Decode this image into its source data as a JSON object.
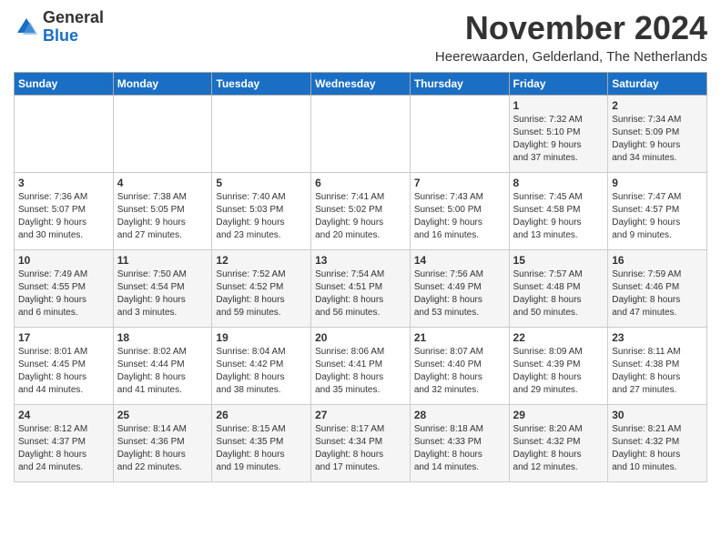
{
  "header": {
    "title": "November 2024",
    "location": "Heerewaarden, Gelderland, The Netherlands",
    "logo_general": "General",
    "logo_blue": "Blue"
  },
  "days_of_week": [
    "Sunday",
    "Monday",
    "Tuesday",
    "Wednesday",
    "Thursday",
    "Friday",
    "Saturday"
  ],
  "weeks": [
    [
      {
        "day": "",
        "info": ""
      },
      {
        "day": "",
        "info": ""
      },
      {
        "day": "",
        "info": ""
      },
      {
        "day": "",
        "info": ""
      },
      {
        "day": "",
        "info": ""
      },
      {
        "day": "1",
        "info": "Sunrise: 7:32 AM\nSunset: 5:10 PM\nDaylight: 9 hours\nand 37 minutes."
      },
      {
        "day": "2",
        "info": "Sunrise: 7:34 AM\nSunset: 5:09 PM\nDaylight: 9 hours\nand 34 minutes."
      }
    ],
    [
      {
        "day": "3",
        "info": "Sunrise: 7:36 AM\nSunset: 5:07 PM\nDaylight: 9 hours\nand 30 minutes."
      },
      {
        "day": "4",
        "info": "Sunrise: 7:38 AM\nSunset: 5:05 PM\nDaylight: 9 hours\nand 27 minutes."
      },
      {
        "day": "5",
        "info": "Sunrise: 7:40 AM\nSunset: 5:03 PM\nDaylight: 9 hours\nand 23 minutes."
      },
      {
        "day": "6",
        "info": "Sunrise: 7:41 AM\nSunset: 5:02 PM\nDaylight: 9 hours\nand 20 minutes."
      },
      {
        "day": "7",
        "info": "Sunrise: 7:43 AM\nSunset: 5:00 PM\nDaylight: 9 hours\nand 16 minutes."
      },
      {
        "day": "8",
        "info": "Sunrise: 7:45 AM\nSunset: 4:58 PM\nDaylight: 9 hours\nand 13 minutes."
      },
      {
        "day": "9",
        "info": "Sunrise: 7:47 AM\nSunset: 4:57 PM\nDaylight: 9 hours\nand 9 minutes."
      }
    ],
    [
      {
        "day": "10",
        "info": "Sunrise: 7:49 AM\nSunset: 4:55 PM\nDaylight: 9 hours\nand 6 minutes."
      },
      {
        "day": "11",
        "info": "Sunrise: 7:50 AM\nSunset: 4:54 PM\nDaylight: 9 hours\nand 3 minutes."
      },
      {
        "day": "12",
        "info": "Sunrise: 7:52 AM\nSunset: 4:52 PM\nDaylight: 8 hours\nand 59 minutes."
      },
      {
        "day": "13",
        "info": "Sunrise: 7:54 AM\nSunset: 4:51 PM\nDaylight: 8 hours\nand 56 minutes."
      },
      {
        "day": "14",
        "info": "Sunrise: 7:56 AM\nSunset: 4:49 PM\nDaylight: 8 hours\nand 53 minutes."
      },
      {
        "day": "15",
        "info": "Sunrise: 7:57 AM\nSunset: 4:48 PM\nDaylight: 8 hours\nand 50 minutes."
      },
      {
        "day": "16",
        "info": "Sunrise: 7:59 AM\nSunset: 4:46 PM\nDaylight: 8 hours\nand 47 minutes."
      }
    ],
    [
      {
        "day": "17",
        "info": "Sunrise: 8:01 AM\nSunset: 4:45 PM\nDaylight: 8 hours\nand 44 minutes."
      },
      {
        "day": "18",
        "info": "Sunrise: 8:02 AM\nSunset: 4:44 PM\nDaylight: 8 hours\nand 41 minutes."
      },
      {
        "day": "19",
        "info": "Sunrise: 8:04 AM\nSunset: 4:42 PM\nDaylight: 8 hours\nand 38 minutes."
      },
      {
        "day": "20",
        "info": "Sunrise: 8:06 AM\nSunset: 4:41 PM\nDaylight: 8 hours\nand 35 minutes."
      },
      {
        "day": "21",
        "info": "Sunrise: 8:07 AM\nSunset: 4:40 PM\nDaylight: 8 hours\nand 32 minutes."
      },
      {
        "day": "22",
        "info": "Sunrise: 8:09 AM\nSunset: 4:39 PM\nDaylight: 8 hours\nand 29 minutes."
      },
      {
        "day": "23",
        "info": "Sunrise: 8:11 AM\nSunset: 4:38 PM\nDaylight: 8 hours\nand 27 minutes."
      }
    ],
    [
      {
        "day": "24",
        "info": "Sunrise: 8:12 AM\nSunset: 4:37 PM\nDaylight: 8 hours\nand 24 minutes."
      },
      {
        "day": "25",
        "info": "Sunrise: 8:14 AM\nSunset: 4:36 PM\nDaylight: 8 hours\nand 22 minutes."
      },
      {
        "day": "26",
        "info": "Sunrise: 8:15 AM\nSunset: 4:35 PM\nDaylight: 8 hours\nand 19 minutes."
      },
      {
        "day": "27",
        "info": "Sunrise: 8:17 AM\nSunset: 4:34 PM\nDaylight: 8 hours\nand 17 minutes."
      },
      {
        "day": "28",
        "info": "Sunrise: 8:18 AM\nSunset: 4:33 PM\nDaylight: 8 hours\nand 14 minutes."
      },
      {
        "day": "29",
        "info": "Sunrise: 8:20 AM\nSunset: 4:32 PM\nDaylight: 8 hours\nand 12 minutes."
      },
      {
        "day": "30",
        "info": "Sunrise: 8:21 AM\nSunset: 4:32 PM\nDaylight: 8 hours\nand 10 minutes."
      }
    ]
  ]
}
